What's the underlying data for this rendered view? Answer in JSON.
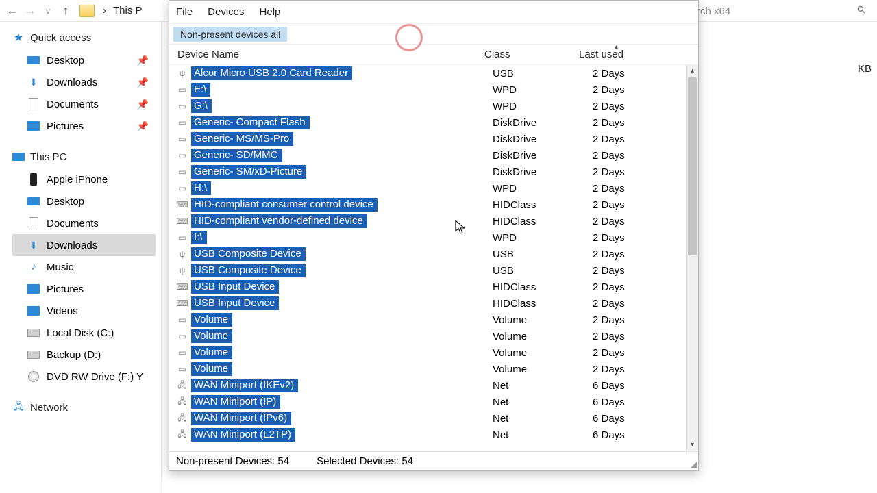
{
  "explorer": {
    "address_prefix": "›",
    "address_text": "This P",
    "search_placeholder": "rch x64",
    "kb_suffix": "KB",
    "sidebar": {
      "quick_access": "Quick access",
      "this_pc": "This PC",
      "network": "Network",
      "quick_items": [
        {
          "label": "Desktop",
          "icon": "desktop",
          "pinned": true
        },
        {
          "label": "Downloads",
          "icon": "down",
          "pinned": true
        },
        {
          "label": "Documents",
          "icon": "doc",
          "pinned": true
        },
        {
          "label": "Pictures",
          "icon": "pic",
          "pinned": true
        }
      ],
      "pc_items": [
        {
          "label": "Apple iPhone",
          "icon": "phone"
        },
        {
          "label": "Desktop",
          "icon": "desktop"
        },
        {
          "label": "Documents",
          "icon": "doc"
        },
        {
          "label": "Downloads",
          "icon": "down",
          "selected": true
        },
        {
          "label": "Music",
          "icon": "music"
        },
        {
          "label": "Pictures",
          "icon": "pic"
        },
        {
          "label": "Videos",
          "icon": "video"
        },
        {
          "label": "Local Disk (C:)",
          "icon": "disk"
        },
        {
          "label": "Backup (D:)",
          "icon": "disk"
        },
        {
          "label": "DVD RW Drive (F:) Y",
          "icon": "dvd"
        }
      ]
    }
  },
  "app": {
    "menu": {
      "file": "File",
      "devices": "Devices",
      "help": "Help"
    },
    "toolbar_button": "Non-present devices all",
    "columns": {
      "name": "Device Name",
      "class": "Class",
      "last": "Last used"
    },
    "status_left": "Non-present Devices: 54",
    "status_right": "Selected Devices: 54",
    "rows": [
      {
        "name": "Alcor Micro USB 2.0 Card Reader",
        "class": "USB",
        "last": "2 Days",
        "icon": "usb"
      },
      {
        "name": "E:\\",
        "class": "WPD",
        "last": "2 Days",
        "icon": "drive"
      },
      {
        "name": "G:\\",
        "class": "WPD",
        "last": "2 Days",
        "icon": "drive"
      },
      {
        "name": "Generic- Compact Flash",
        "class": "DiskDrive",
        "last": "2 Days",
        "icon": "disk"
      },
      {
        "name": "Generic- MS/MS-Pro",
        "class": "DiskDrive",
        "last": "2 Days",
        "icon": "disk"
      },
      {
        "name": "Generic- SD/MMC",
        "class": "DiskDrive",
        "last": "2 Days",
        "icon": "disk"
      },
      {
        "name": "Generic- SM/xD-Picture",
        "class": "DiskDrive",
        "last": "2 Days",
        "icon": "disk"
      },
      {
        "name": "H:\\",
        "class": "WPD",
        "last": "2 Days",
        "icon": "drive"
      },
      {
        "name": "HID-compliant consumer control device",
        "class": "HIDClass",
        "last": "2 Days",
        "icon": "hid"
      },
      {
        "name": "HID-compliant vendor-defined device",
        "class": "HIDClass",
        "last": "2 Days",
        "icon": "hid"
      },
      {
        "name": "I:\\",
        "class": "WPD",
        "last": "2 Days",
        "icon": "drive"
      },
      {
        "name": "USB Composite Device",
        "class": "USB",
        "last": "2 Days",
        "icon": "usb"
      },
      {
        "name": "USB Composite Device",
        "class": "USB",
        "last": "2 Days",
        "icon": "usb"
      },
      {
        "name": "USB Input Device",
        "class": "HIDClass",
        "last": "2 Days",
        "icon": "hid"
      },
      {
        "name": "USB Input Device",
        "class": "HIDClass",
        "last": "2 Days",
        "icon": "hid"
      },
      {
        "name": "Volume",
        "class": "Volume",
        "last": "2 Days",
        "icon": "disk"
      },
      {
        "name": "Volume",
        "class": "Volume",
        "last": "2 Days",
        "icon": "disk"
      },
      {
        "name": "Volume",
        "class": "Volume",
        "last": "2 Days",
        "icon": "disk"
      },
      {
        "name": "Volume",
        "class": "Volume",
        "last": "2 Days",
        "icon": "disk"
      },
      {
        "name": "WAN Miniport (IKEv2)",
        "class": "Net",
        "last": "6 Days",
        "icon": "net"
      },
      {
        "name": "WAN Miniport (IP)",
        "class": "Net",
        "last": "6 Days",
        "icon": "net"
      },
      {
        "name": "WAN Miniport (IPv6)",
        "class": "Net",
        "last": "6 Days",
        "icon": "net"
      },
      {
        "name": "WAN Miniport (L2TP)",
        "class": "Net",
        "last": "6 Days",
        "icon": "net"
      }
    ]
  }
}
